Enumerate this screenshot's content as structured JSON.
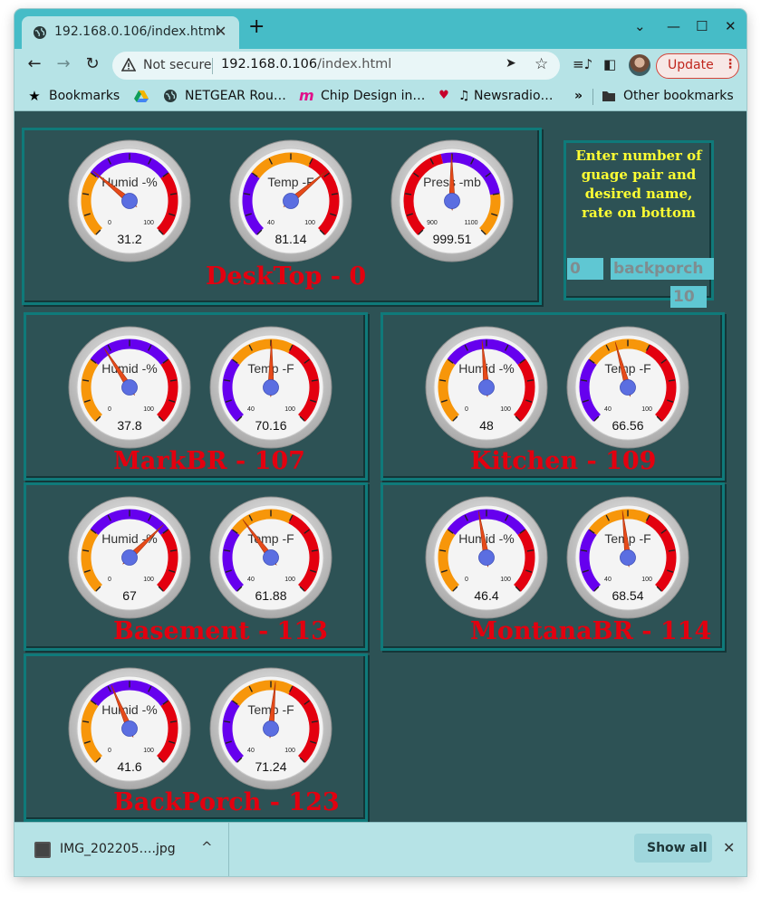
{
  "browser": {
    "tab_title": "192.168.0.106/index.html",
    "tab_close": "✕",
    "new_tab": "+",
    "window_controls": [
      "⌄",
      "—",
      "☐",
      "✕"
    ],
    "not_secure": "Not secure",
    "url_host": "192.168.0.106",
    "url_path": "/index.html",
    "update_label": "Update",
    "update_menu": "⋮",
    "bookmarks": [
      "Bookmarks",
      "NETGEAR Rou…",
      "Chip Design in…",
      "♫ Newsradio…"
    ],
    "bookmarks_more": "»",
    "other_bookmarks": "Other bookmarks"
  },
  "form": {
    "instructions": "Enter number of guage pair and desired name, rate on bottom",
    "number_value": "0",
    "name_value": "backporch",
    "rate_value": "10"
  },
  "colors": {
    "humidity_low": "#f7960a",
    "humidity_mid": "#6600ee",
    "temp_low": "#6600ee",
    "temp_mid": "#f7960a",
    "high": "#e3000f",
    "needle": "#e64a19",
    "hub": "#5b6ee1",
    "label": "#e3000f",
    "background": "#2d5255"
  },
  "panels": [
    {
      "label": "DeskTop - 0",
      "gauges": [
        {
          "title": "Humid -%",
          "min": 0,
          "max": 100,
          "min_label": "0",
          "max_label": "100",
          "value": 31.2,
          "value_label": "31.2",
          "kind": "humidity"
        },
        {
          "title": "Temp -F",
          "min": 40,
          "max": 100,
          "min_label": "40",
          "max_label": "100",
          "value": 81.14,
          "value_label": "81.14",
          "kind": "temp"
        },
        {
          "title": "Press -mb",
          "min": 900,
          "max": 1100,
          "min_label": "900",
          "max_label": "1100",
          "value": 999.51,
          "value_label": "999.51",
          "kind": "pressure"
        }
      ]
    },
    {
      "label": "MarkBR - 107",
      "gauges": [
        {
          "title": "Humid -%",
          "min": 0,
          "max": 100,
          "min_label": "0",
          "max_label": "100",
          "value": 37.8,
          "value_label": "37.8",
          "kind": "humidity"
        },
        {
          "title": "Temp -F",
          "min": 40,
          "max": 100,
          "min_label": "40",
          "max_label": "100",
          "value": 70.16,
          "value_label": "70.16",
          "kind": "temp"
        }
      ]
    },
    {
      "label": "Kitchen - 109",
      "gauges": [
        {
          "title": "Humid -%",
          "min": 0,
          "max": 100,
          "min_label": "0",
          "max_label": "100",
          "value": 48,
          "value_label": "48",
          "kind": "humidity"
        },
        {
          "title": "Temp -F",
          "min": 40,
          "max": 100,
          "min_label": "40",
          "max_label": "100",
          "value": 66.56,
          "value_label": "66.56",
          "kind": "temp"
        }
      ]
    },
    {
      "label": "Basement - 113",
      "gauges": [
        {
          "title": "Humid -%",
          "min": 0,
          "max": 100,
          "min_label": "0",
          "max_label": "100",
          "value": 67,
          "value_label": "67",
          "kind": "humidity"
        },
        {
          "title": "Temp -F",
          "min": 40,
          "max": 100,
          "min_label": "40",
          "max_label": "100",
          "value": 61.88,
          "value_label": "61.88",
          "kind": "temp"
        }
      ]
    },
    {
      "label": "MontanaBR - 114",
      "gauges": [
        {
          "title": "Humid -%",
          "min": 0,
          "max": 100,
          "min_label": "0",
          "max_label": "100",
          "value": 46.4,
          "value_label": "46.4",
          "kind": "humidity"
        },
        {
          "title": "Temp -F",
          "min": 40,
          "max": 100,
          "min_label": "40",
          "max_label": "100",
          "value": 68.54,
          "value_label": "68.54",
          "kind": "temp"
        }
      ]
    },
    {
      "label": "BackPorch - 123",
      "gauges": [
        {
          "title": "Humid -%",
          "min": 0,
          "max": 100,
          "min_label": "0",
          "max_label": "100",
          "value": 41.6,
          "value_label": "41.6",
          "kind": "humidity"
        },
        {
          "title": "Temp -F",
          "min": 40,
          "max": 100,
          "min_label": "40",
          "max_label": "100",
          "value": 71.24,
          "value_label": "71.24",
          "kind": "temp"
        }
      ]
    }
  ],
  "downloads": {
    "file_name": "IMG_202205….jpg",
    "chevron": "^",
    "show_all": "Show all",
    "close": "✕"
  }
}
